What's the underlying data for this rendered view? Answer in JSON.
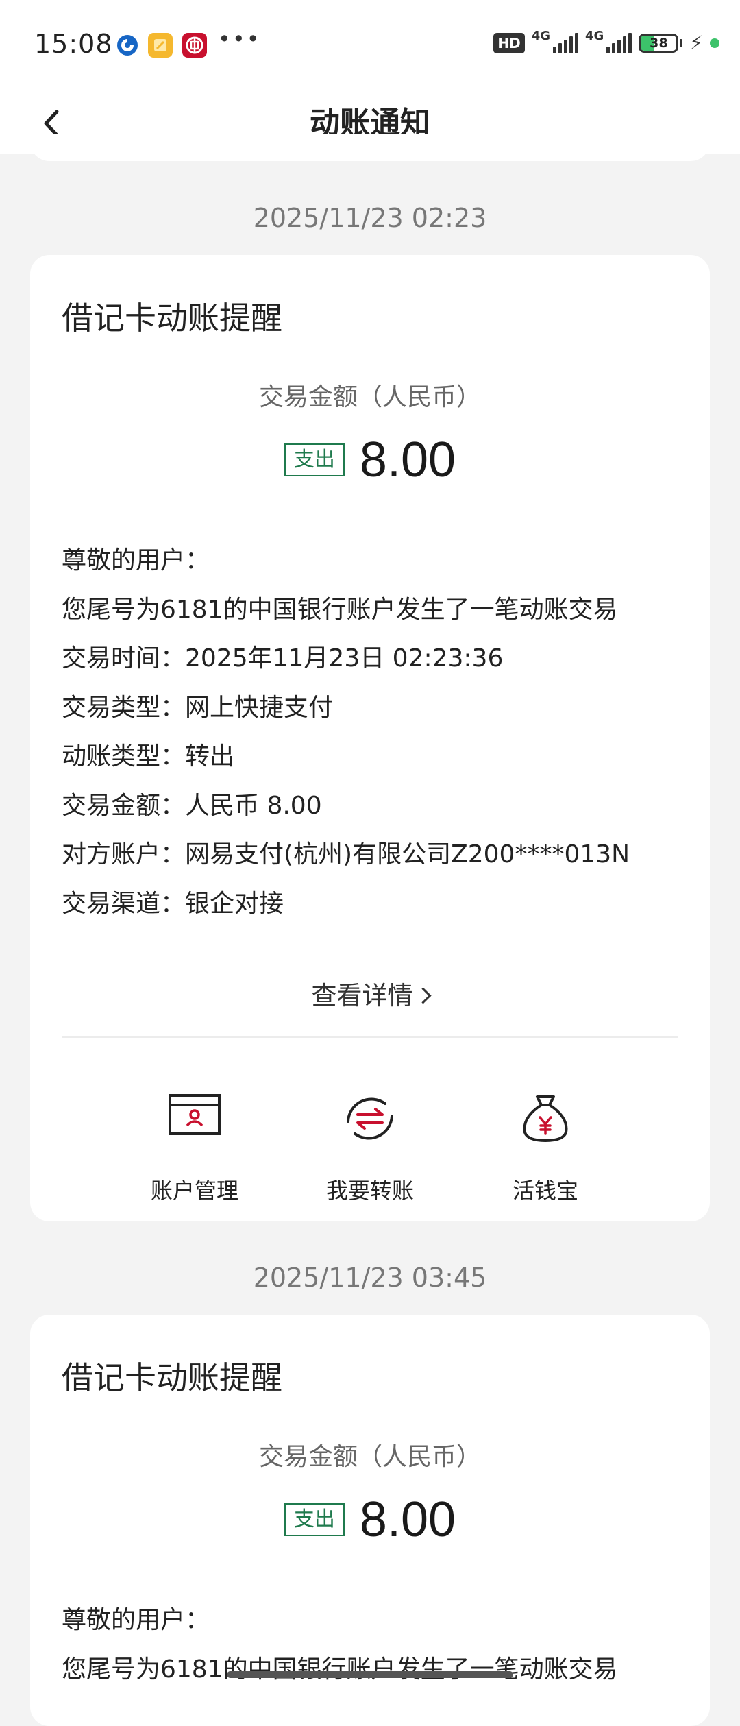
{
  "status_bar": {
    "time": "15:08",
    "hd": "HD",
    "network1": "4G",
    "network2": "4G",
    "battery": "38",
    "battery_fraction": 0.38,
    "icons": [
      "bank-app-icon",
      "notes-app-icon",
      "boc-app-icon",
      "more-notifications-icon"
    ],
    "dots": "•••"
  },
  "nav": {
    "title": "动账通知",
    "back_icon": "chevron-left-icon"
  },
  "notifications": [
    {
      "date": "2025/11/23 02:23",
      "title": "借记卡动账提醒",
      "amount_label": "交易金额（人民币）",
      "type_badge": "支出",
      "amount": "8.00",
      "lines": [
        "尊敬的用户：",
        "您尾号为6181的中国银行账户发生了一笔动账交易",
        "交易时间：2025年11月23日 02:23:36",
        "交易类型：网上快捷支付",
        "动账类型：转出",
        "交易金额：人民币 8.00",
        "对方账户：网易支付(杭州)有限公司Z200****013N",
        "交易渠道：银企对接"
      ],
      "view_detail": "查看详情",
      "actions": [
        {
          "label": "账户管理",
          "icon": "account-card-icon"
        },
        {
          "label": "我要转账",
          "icon": "transfer-icon"
        },
        {
          "label": "活钱宝",
          "icon": "money-bag-icon"
        }
      ]
    },
    {
      "date": "2025/11/23 03:45",
      "title": "借记卡动账提醒",
      "amount_label": "交易金额（人民币）",
      "type_badge": "支出",
      "amount": "8.00",
      "lines": [
        "尊敬的用户：",
        "您尾号为6181的中国银行账户发生了一笔动账交易"
      ]
    }
  ],
  "colors": {
    "accent_green": "#1f7a4d",
    "icon_red": "#c8102e",
    "page_bg": "#f3f3f3"
  }
}
